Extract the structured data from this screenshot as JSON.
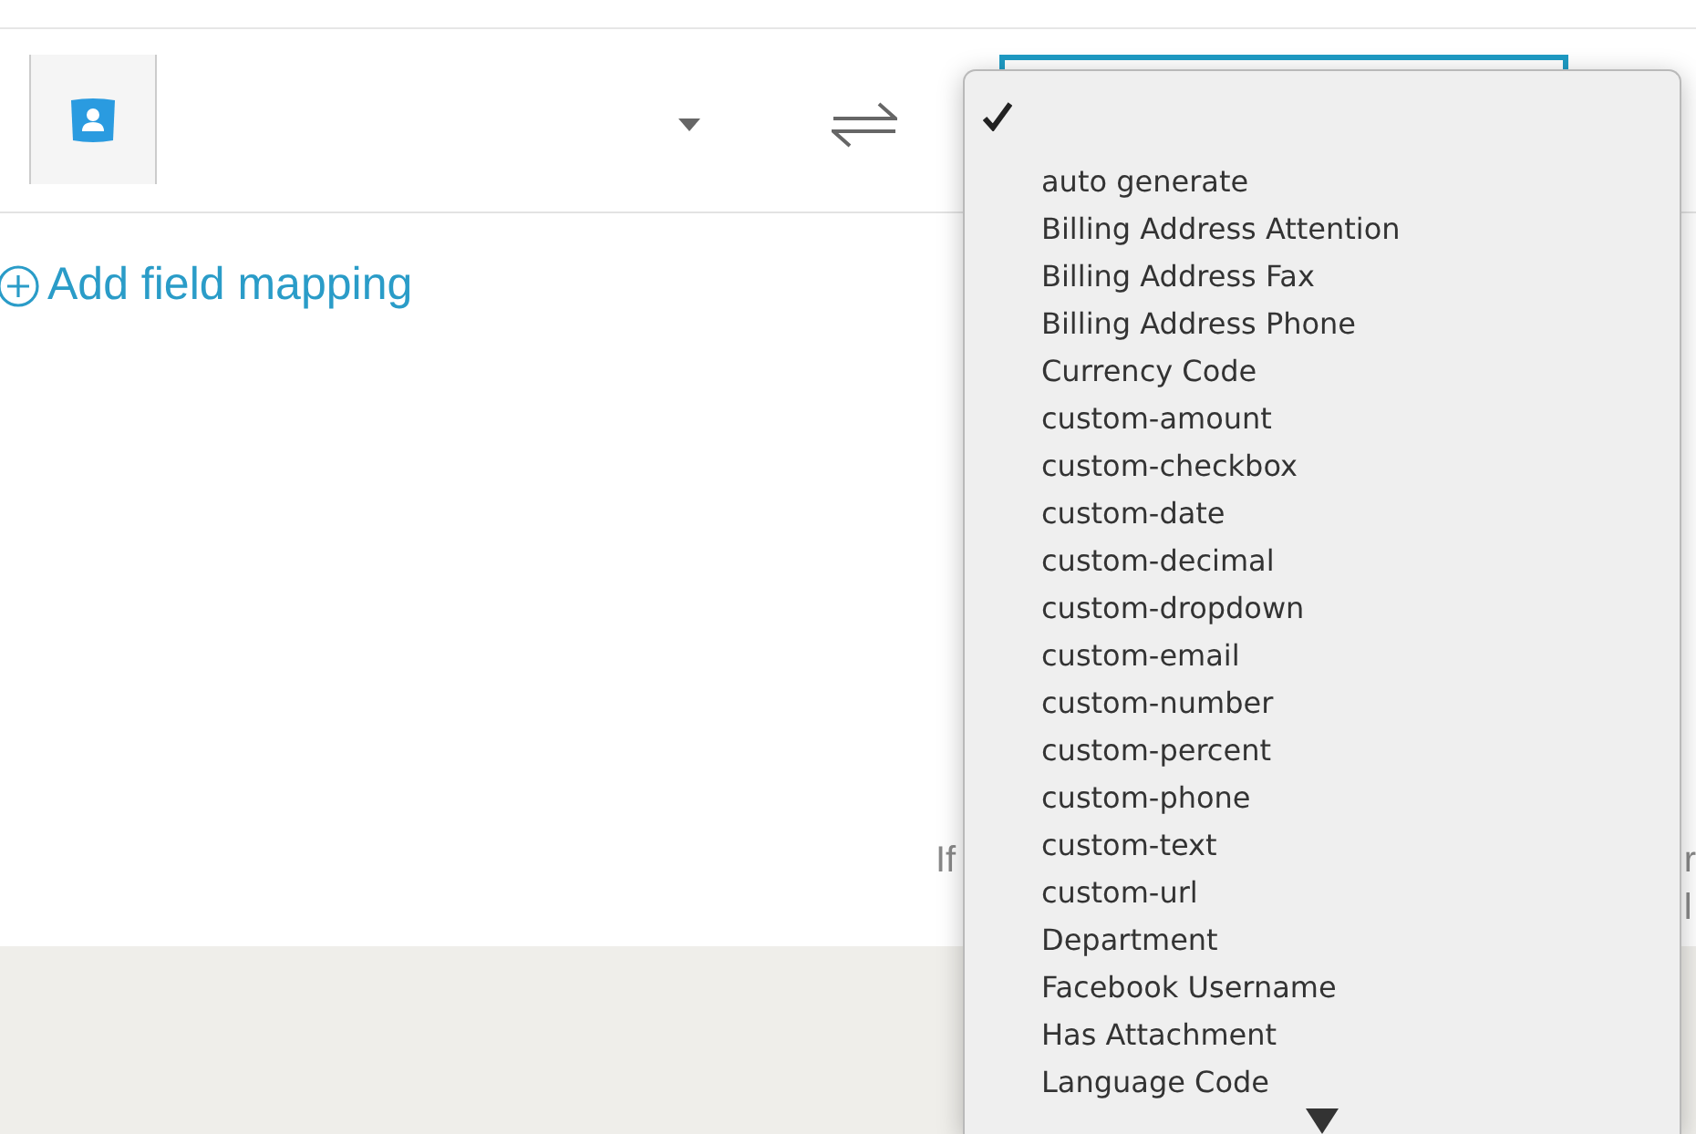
{
  "mapping_row": {
    "source_dropdown": {
      "expanded": false
    },
    "target_field": {
      "focused": true
    }
  },
  "add_link": {
    "label": "Add field mapping"
  },
  "hint": {
    "left_fragment": "If",
    "right_fragments": [
      "r",
      "l"
    ]
  },
  "menu": {
    "items": [
      {
        "selected": true
      },
      {
        "label": "auto generate",
        "selected": false
      },
      {
        "label": "Billing Address Attention",
        "selected": false
      },
      {
        "label": "Billing Address Fax",
        "selected": false
      },
      {
        "label": "Billing Address Phone",
        "selected": false
      },
      {
        "label": "Currency Code",
        "selected": false
      },
      {
        "label": "custom-amount",
        "selected": false
      },
      {
        "label": "custom-checkbox",
        "selected": false
      },
      {
        "label": "custom-date",
        "selected": false
      },
      {
        "label": "custom-decimal",
        "selected": false
      },
      {
        "label": "custom-dropdown",
        "selected": false
      },
      {
        "label": "custom-email",
        "selected": false
      },
      {
        "label": "custom-number",
        "selected": false
      },
      {
        "label": "custom-percent",
        "selected": false
      },
      {
        "label": "custom-phone",
        "selected": false
      },
      {
        "label": "custom-text",
        "selected": false
      },
      {
        "label": "custom-url",
        "selected": false
      },
      {
        "label": "Department",
        "selected": false
      },
      {
        "label": "Facebook Username",
        "selected": false
      },
      {
        "label": "Has Attachment",
        "selected": false
      },
      {
        "label": "Language Code",
        "selected": false
      }
    ],
    "more_below": true
  }
}
